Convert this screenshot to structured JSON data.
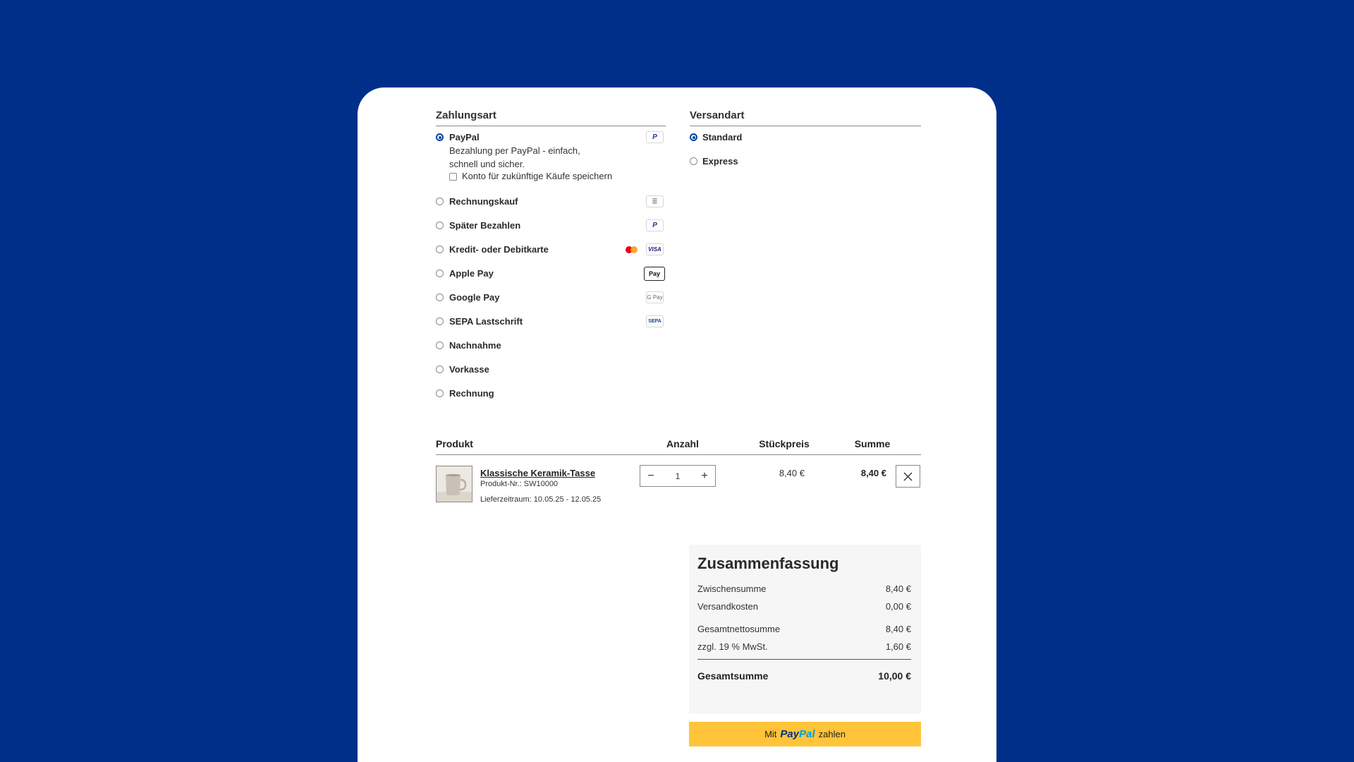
{
  "payment": {
    "title": "Zahlungsart",
    "options": [
      {
        "label": "PayPal",
        "checked": true,
        "logo": "paypal-icon"
      },
      {
        "label": "Rechnungskauf",
        "checked": false,
        "logo": "invoice-icon"
      },
      {
        "label": "Später Bezahlen",
        "checked": false,
        "logo": "paypal-icon"
      },
      {
        "label": "Kredit- oder Debitkarte",
        "checked": false,
        "logo": "card-icons"
      },
      {
        "label": "Apple Pay",
        "checked": false,
        "logo": "apple-pay-icon"
      },
      {
        "label": "Google Pay",
        "checked": false,
        "logo": "google-pay-icon"
      },
      {
        "label": "SEPA Lastschrift",
        "checked": false,
        "logo": "sepa-icon"
      },
      {
        "label": "Nachnahme",
        "checked": false
      },
      {
        "label": "Vorkasse",
        "checked": false
      },
      {
        "label": "Rechnung",
        "checked": false
      }
    ],
    "paypal_desc_line1": "Bezahlung per PayPal - einfach,",
    "paypal_desc_line2": "schnell und sicher.",
    "save_account_label": "Konto für zukünftige Käufe speichern",
    "logo_texts": {
      "paypal": "P",
      "visa": "VISA",
      "apple_pay": "Pay",
      "google_pay": "G Pay",
      "sepa": "SEPA"
    }
  },
  "shipping": {
    "title": "Versandart",
    "options": [
      {
        "label": "Standard",
        "checked": true
      },
      {
        "label": "Express",
        "checked": false
      }
    ]
  },
  "cart": {
    "headers": {
      "product": "Produkt",
      "quantity": "Anzahl",
      "unit_price": "Stückpreis",
      "total": "Summe"
    },
    "items": [
      {
        "name": "Klassische Keramik-Tasse",
        "product_no": "Produkt-Nr.: SW10000",
        "delivery": "Lieferzeitraum: 10.05.25 - 12.05.25",
        "quantity": "1",
        "unit_price": "8,40 €",
        "total": "8,40 €"
      }
    ]
  },
  "summary": {
    "title": "Zusammenfassung",
    "rows": [
      {
        "label": "Zwischensumme",
        "value": "8,40 €"
      },
      {
        "label": "Versandkosten",
        "value": "0,00 €"
      },
      {
        "label": "Gesamtnettosumme",
        "value": "8,40 €"
      },
      {
        "label": "zzgl. 19 % MwSt.",
        "value": "1,60 €"
      }
    ],
    "total_label": "Gesamtsumme",
    "total_value": "10,00 €"
  },
  "paypal_button": {
    "prefix": "Mit",
    "brand_part1": "Pay",
    "brand_part2": "Pal",
    "suffix": "zahlen"
  },
  "colors": {
    "background": "#002f8a",
    "accent": "#0b3fa8",
    "paypal_yellow": "#ffc439"
  }
}
